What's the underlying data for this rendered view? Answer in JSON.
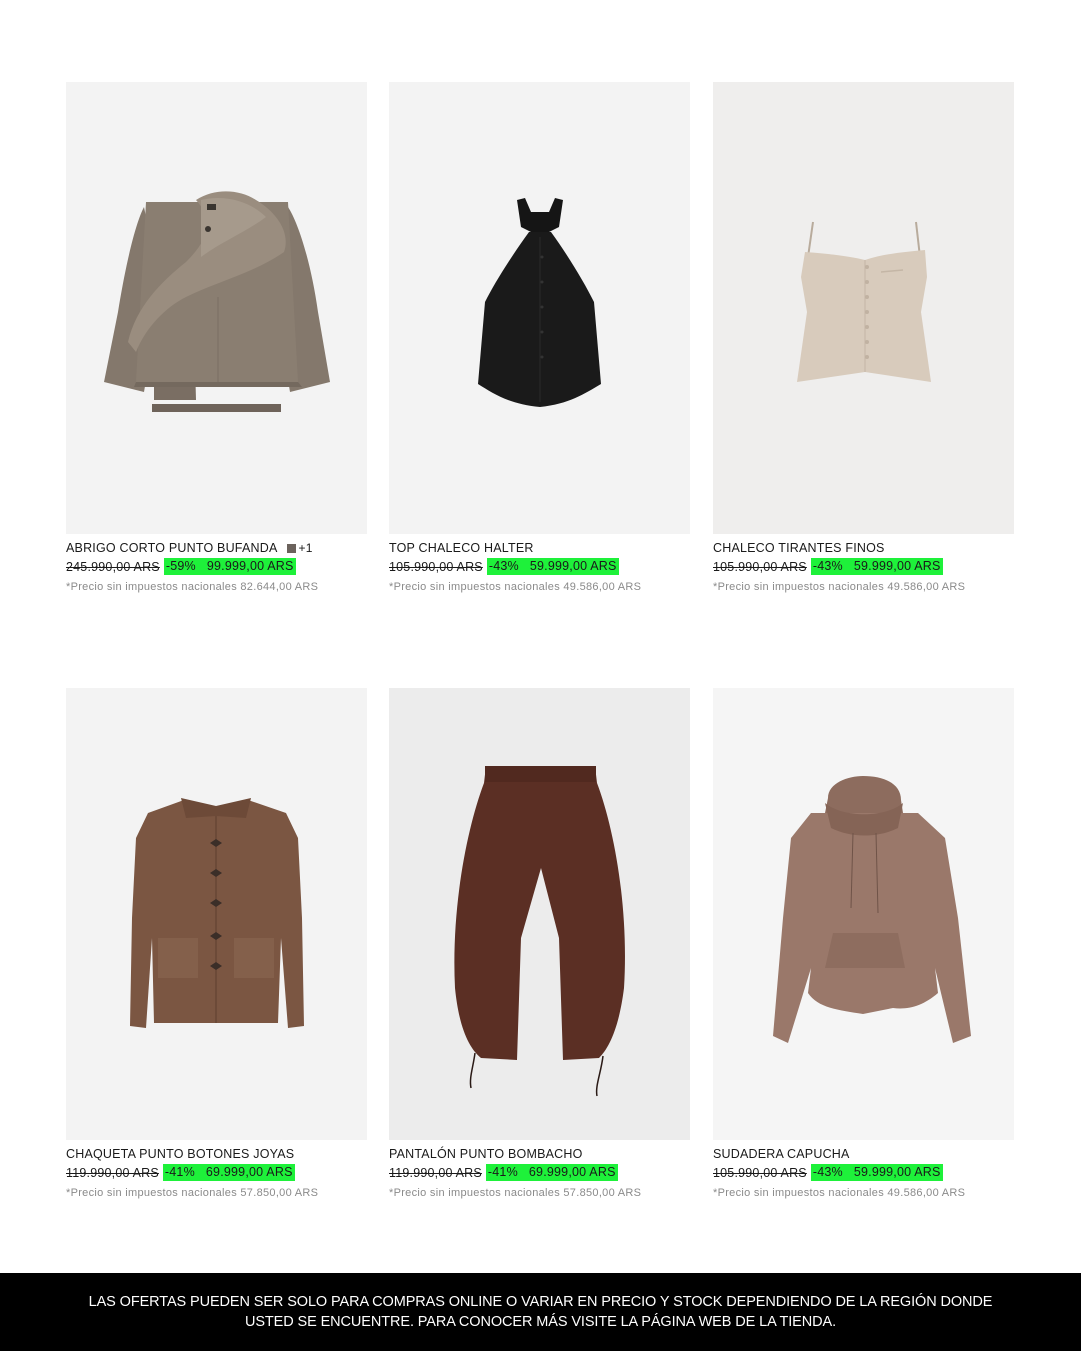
{
  "products": [
    {
      "name": "ABRIGO CORTO PUNTO BUFANDA",
      "swatch_color": "#6b625c",
      "more_colors": "+1",
      "old_price": "245.990,00 ARS",
      "discount": "-59%",
      "new_price": "99.999,00 ARS",
      "tax_note": "*Precio sin impuestos nacionales 82.644,00 ARS",
      "image_icon": "knit-scarf-coat-image",
      "bg_color": "#f3f3f3"
    },
    {
      "name": "TOP CHALECO HALTER",
      "old_price": "105.990,00 ARS",
      "discount": "-43%",
      "new_price": "59.999,00 ARS",
      "tax_note": "*Precio sin impuestos nacionales 49.586,00 ARS",
      "image_icon": "black-halter-top-image",
      "bg_color": "#f3f3f3"
    },
    {
      "name": "CHALECO TIRANTES FINOS",
      "old_price": "105.990,00 ARS",
      "discount": "-43%",
      "new_price": "59.999,00 ARS",
      "tax_note": "*Precio sin impuestos nacionales 49.586,00 ARS",
      "image_icon": "beige-strappy-vest-image",
      "bg_color": "#efeeed"
    },
    {
      "name": "CHAQUETA PUNTO BOTONES JOYAS",
      "old_price": "119.990,00 ARS",
      "discount": "-41%",
      "new_price": "69.999,00 ARS",
      "tax_note": "*Precio sin impuestos nacionales 57.850,00 ARS",
      "image_icon": "brown-knit-cardigan-image",
      "bg_color": "#f3f3f3"
    },
    {
      "name": "PANTALÓN PUNTO BOMBACHO",
      "old_price": "119.990,00 ARS",
      "discount": "-41%",
      "new_price": "69.999,00 ARS",
      "tax_note": "*Precio sin impuestos nacionales 57.850,00 ARS",
      "image_icon": "brown-balloon-pants-image",
      "bg_color": "#ececec"
    },
    {
      "name": "SUDADERA CAPUCHA",
      "old_price": "105.990,00 ARS",
      "discount": "-43%",
      "new_price": "59.999,00 ARS",
      "tax_note": "*Precio sin impuestos nacionales 49.586,00 ARS",
      "image_icon": "mauve-hoodie-image",
      "bg_color": "#f5f5f5"
    }
  ],
  "colors": {
    "discount_highlight": "#1ef13a",
    "footer_bg": "#000000"
  },
  "footer": {
    "text": "LAS OFERTAS PUEDEN SER SOLO PARA COMPRAS ONLINE O VARIAR EN PRECIO Y STOCK DEPENDIENDO DE LA REGIÓN DONDE USTED SE ENCUENTRE. PARA CONOCER MÁS VISITE LA PÁGINA WEB DE LA TIENDA."
  }
}
